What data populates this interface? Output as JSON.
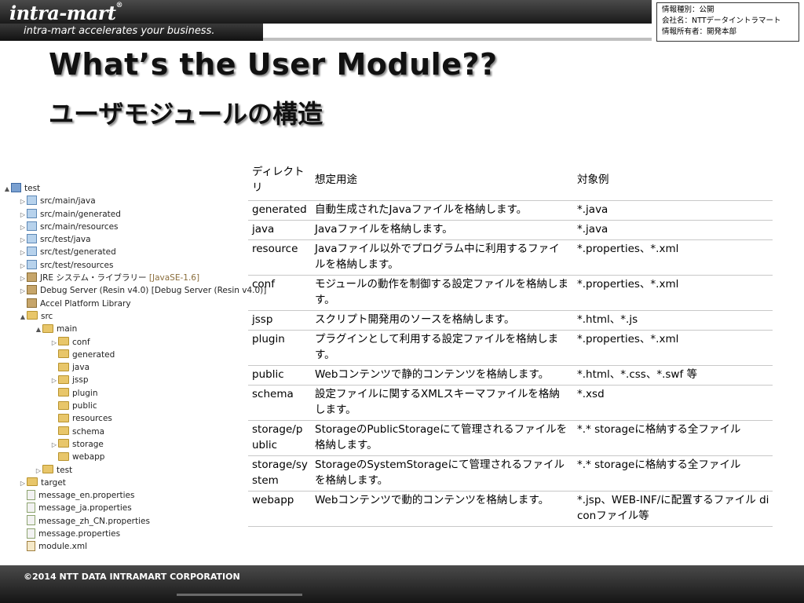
{
  "header": {
    "logo": "intra-mart",
    "logo_reg": "®",
    "tagline": "intra-mart accelerates your business.",
    "info": [
      "情報種別：公開",
      "会社名：NTTデータイントラマート",
      "情報所有者：開発本部"
    ]
  },
  "titles": {
    "en": "What’s the User Module??",
    "ja": "ユーザモジュールの構造"
  },
  "tree": [
    {
      "label": "test",
      "icon": "project-icon",
      "arrow": "▲",
      "indent": 0
    },
    {
      "label": "src/main/java",
      "icon": "package-folder-icon",
      "arrow": "▷",
      "indent": 1
    },
    {
      "label": "src/main/generated",
      "icon": "package-folder-icon",
      "arrow": "▷",
      "indent": 1
    },
    {
      "label": "src/main/resources",
      "icon": "package-folder-icon",
      "arrow": "▷",
      "indent": 1
    },
    {
      "label": "src/test/java",
      "icon": "package-folder-icon",
      "arrow": "▷",
      "indent": 1
    },
    {
      "label": "src/test/generated",
      "icon": "package-folder-icon",
      "arrow": "▷",
      "indent": 1
    },
    {
      "label": "src/test/resources",
      "icon": "package-folder-icon",
      "arrow": "▷",
      "indent": 1
    },
    {
      "label": "JRE システム・ライブラリー",
      "extra": "[JavaSE-1.6]",
      "icon": "library-icon",
      "arrow": "▷",
      "indent": 1
    },
    {
      "label": "Debug Server (Resin v4.0) [Debug Server (Resin v4.0)]",
      "icon": "library-icon",
      "arrow": "▷",
      "indent": 1
    },
    {
      "label": "Accel Platform Library",
      "icon": "library-icon",
      "arrow": "",
      "indent": 1
    },
    {
      "label": "src",
      "icon": "folder-icon",
      "arrow": "▲",
      "indent": 1
    },
    {
      "label": "main",
      "icon": "folder-icon",
      "arrow": "▲",
      "indent": 2
    },
    {
      "label": "conf",
      "icon": "folder-icon",
      "arrow": "▷",
      "indent": 3
    },
    {
      "label": "generated",
      "icon": "folder-icon",
      "arrow": "",
      "indent": 3
    },
    {
      "label": "java",
      "icon": "folder-icon",
      "arrow": "",
      "indent": 3
    },
    {
      "label": "jssp",
      "icon": "folder-icon",
      "arrow": "▷",
      "indent": 3
    },
    {
      "label": "plugin",
      "icon": "folder-icon",
      "arrow": "",
      "indent": 3
    },
    {
      "label": "public",
      "icon": "folder-icon",
      "arrow": "",
      "indent": 3
    },
    {
      "label": "resources",
      "icon": "folder-icon",
      "arrow": "",
      "indent": 3
    },
    {
      "label": "schema",
      "icon": "folder-icon",
      "arrow": "",
      "indent": 3
    },
    {
      "label": "storage",
      "icon": "folder-icon",
      "arrow": "▷",
      "indent": 3
    },
    {
      "label": "webapp",
      "icon": "folder-icon",
      "arrow": "",
      "indent": 3
    },
    {
      "label": "test",
      "icon": "folder-icon",
      "arrow": "▷",
      "indent": 2
    },
    {
      "label": "target",
      "icon": "folder-icon",
      "arrow": "▷",
      "indent": 1
    },
    {
      "label": "message_en.properties",
      "icon": "file-icon",
      "arrow": "",
      "indent": 1
    },
    {
      "label": "message_ja.properties",
      "icon": "file-icon",
      "arrow": "",
      "indent": 1
    },
    {
      "label": "message_zh_CN.properties",
      "icon": "file-icon",
      "arrow": "",
      "indent": 1
    },
    {
      "label": "message.properties",
      "icon": "file-icon",
      "arrow": "",
      "indent": 1
    },
    {
      "label": "module.xml",
      "icon": "xml-file-icon",
      "arrow": "",
      "indent": 1
    }
  ],
  "table": {
    "headers": [
      "ディレクトリ",
      "想定用途",
      "対象例"
    ],
    "rows": [
      [
        "generated",
        "自動生成されたJavaファイルを格納します。",
        "*.java"
      ],
      [
        "java",
        "Javaファイルを格納します。",
        "*.java"
      ],
      [
        "resource",
        "Javaファイル以外でプログラム中に利用するファイルを格納します。",
        "*.properties、*.xml"
      ],
      [
        "conf",
        "モジュールの動作を制御する設定ファイルを格納します。",
        "*.properties、*.xml"
      ],
      [
        "jssp",
        "スクリプト開発用のソースを格納します。",
        "*.html、*.js"
      ],
      [
        "plugin",
        "プラグインとして利用する設定ファイルを格納します。",
        "*.properties、*.xml"
      ],
      [
        "public",
        "Webコンテンツで静的コンテンツを格納します。",
        "*.html、*.css、*.swf 等"
      ],
      [
        "schema",
        "設定ファイルに関するXMLスキーマファイルを格納します。",
        "*.xsd"
      ],
      [
        "storage/public",
        "StorageのPublicStorageにて管理されるファイルを格納します。",
        "*.* storageに格納する全ファイル"
      ],
      [
        "storage/system",
        "StorageのSystemStorageにて管理されるファイルを格納します。",
        "*.* storageに格納する全ファイル"
      ],
      [
        "webapp",
        "Webコンテンツで動的コンテンツを格納します。",
        "*.jsp、WEB-INF/に配置するファイル diconファイル等"
      ]
    ]
  },
  "footer": {
    "copyright": "©2014 NTT DATA INTRAMART CORPORATION"
  }
}
